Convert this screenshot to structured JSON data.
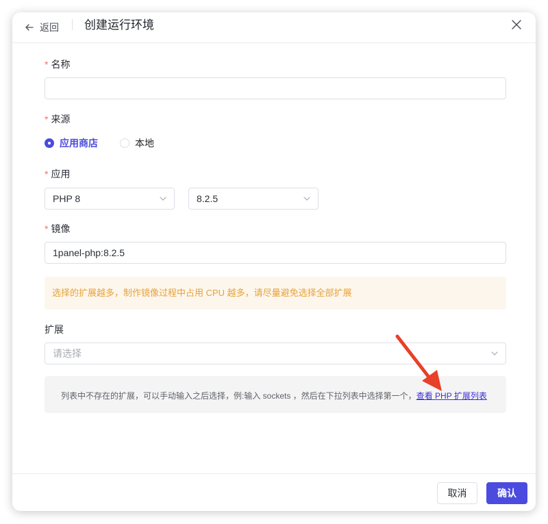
{
  "header": {
    "back_label": "返回",
    "title": "创建运行环境"
  },
  "form": {
    "name": {
      "label": "名称",
      "value": ""
    },
    "source": {
      "label": "来源",
      "options": [
        "应用商店",
        "本地"
      ],
      "selected": "应用商店"
    },
    "app": {
      "label": "应用",
      "app_value": "PHP 8",
      "version_value": "8.2.5"
    },
    "image": {
      "label": "镜像",
      "value": "1panel-php:8.2.5"
    },
    "warning": "选择的扩展越多，制作镜像过程中占用 CPU 越多，请尽量避免选择全部扩展",
    "extensions": {
      "label": "扩展",
      "placeholder": "请选择"
    },
    "tip": {
      "text": "列表中不存在的扩展，可以手动输入之后选择，例:输入 sockets ，然后在下拉列表中选择第一个，",
      "link": "查看 PHP 扩展列表"
    }
  },
  "footer": {
    "cancel_label": "取消",
    "confirm_label": "确认"
  },
  "colors": {
    "accent": "#4b4bdf",
    "required_star": "#f56c6c",
    "warning_bg": "#fdf6ec",
    "warning_text": "#e6a23c",
    "annotation_arrow": "#e8402a"
  },
  "icons": {
    "back": "arrow-left-icon",
    "close": "close-icon",
    "chevron": "chevron-down-icon"
  }
}
